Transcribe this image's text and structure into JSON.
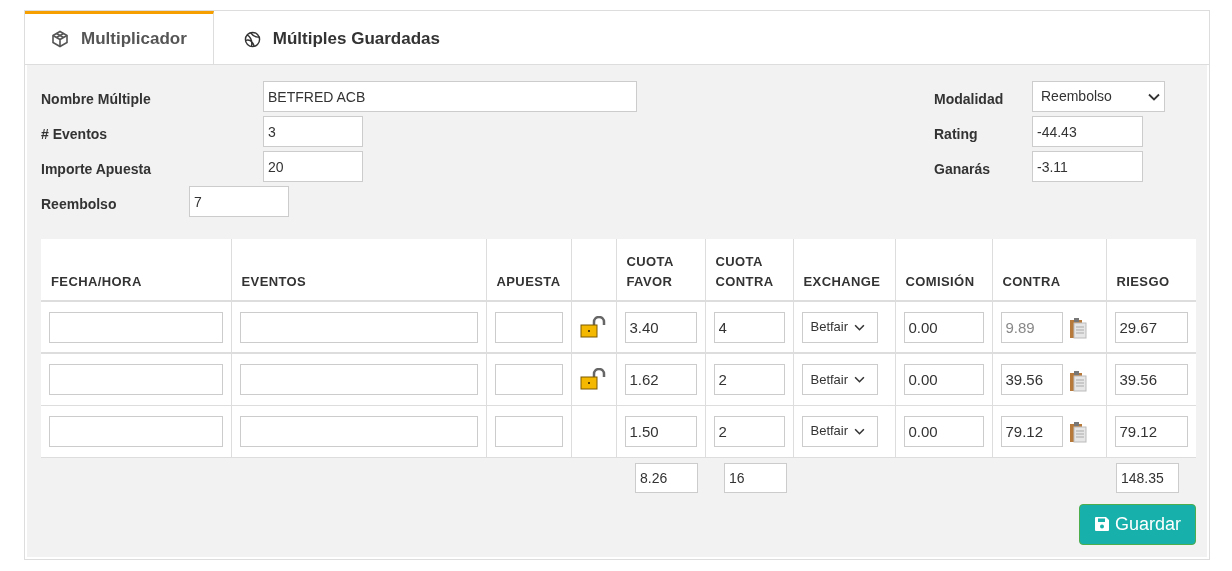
{
  "tabs": [
    {
      "label": "Multiplicador",
      "selected": true
    },
    {
      "label": "Múltiples Guardadas",
      "selected": false
    }
  ],
  "form": {
    "left": [
      {
        "label": "Nombre Múltiple",
        "value": "BETFRED ACB",
        "kind": "wide"
      },
      {
        "label": "# Eventos",
        "value": "3",
        "kind": "short"
      },
      {
        "label": "Importe Apuesta",
        "value": "20",
        "kind": "short"
      },
      {
        "label": "Reembolso",
        "value": "7",
        "kind": "near"
      }
    ],
    "right": [
      {
        "label": "Modalidad",
        "value": "Reembolso",
        "kind": "select"
      },
      {
        "label": "Rating",
        "value": "-44.43",
        "kind": "input"
      },
      {
        "label": "Ganarás",
        "value": "-3.11",
        "kind": "input"
      }
    ]
  },
  "table": {
    "columns": [
      "FECHA/HORA",
      "EVENTOS",
      "APUESTA",
      "CUOTA FAVOR",
      "CUOTA CONTRA",
      "EXCHANGE",
      "COMISIÓN",
      "CONTRA",
      "RIESGO"
    ],
    "rows": [
      {
        "lock_icon": true,
        "cuota_favor": "3.40",
        "cuota_contra": "4",
        "exchange": "Betfair",
        "comision": "0.00",
        "contra": "9.89",
        "contra_disabled": true,
        "riesgo": "29.67"
      },
      {
        "lock_icon": true,
        "cuota_favor": "1.62",
        "cuota_contra": "2",
        "exchange": "Betfair",
        "comision": "0.00",
        "contra": "39.56",
        "contra_disabled": false,
        "riesgo": "39.56"
      },
      {
        "lock_icon": false,
        "cuota_favor": "1.50",
        "cuota_contra": "2",
        "exchange": "Betfair",
        "comision": "0.00",
        "contra": "79.12",
        "contra_disabled": false,
        "riesgo": "79.12"
      }
    ],
    "totals": {
      "cuota_favor": "8.26",
      "cuota_contra": "16",
      "riesgo": "148.35"
    }
  },
  "save_button": "Guardar"
}
